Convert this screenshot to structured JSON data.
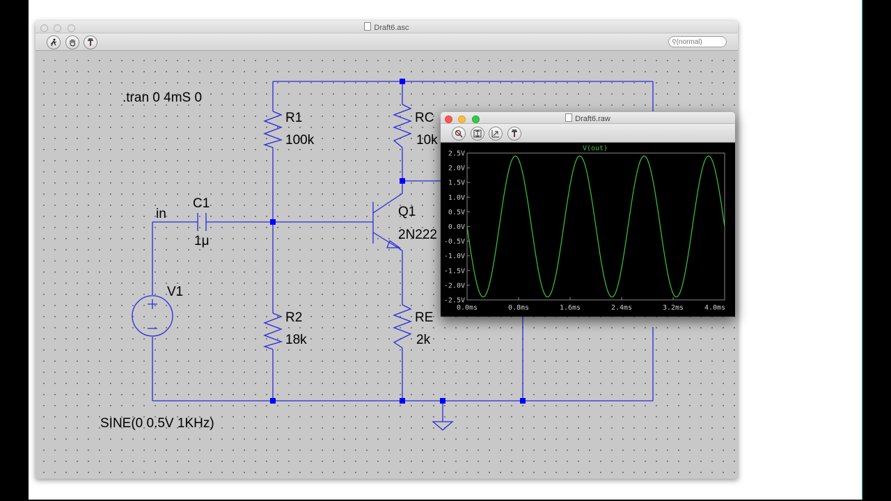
{
  "main_window": {
    "title": "Draft6.asc",
    "search_placeholder": "(normal)",
    "toolbar_icons": [
      "run-icon",
      "pan-hand-icon",
      "probe-icon"
    ]
  },
  "schematic": {
    "directive": ".tran 0 4mS 0",
    "source_spec": "SINE(0 0.5V 1KHz)",
    "net_label": "in",
    "components": {
      "R1": {
        "name": "R1",
        "value": "100k"
      },
      "R2": {
        "name": "R2",
        "value": "18k"
      },
      "RC": {
        "name": "RC",
        "value": "10k"
      },
      "RE": {
        "name": "RE",
        "value": "2k"
      },
      "C1": {
        "name": "C1",
        "value": "1μ"
      },
      "Q1": {
        "name": "Q1",
        "value": "2N222"
      },
      "V1": {
        "name": "V1"
      }
    },
    "colors": {
      "wire": "#2a2adf",
      "junction": "#0000ff"
    }
  },
  "waveform_window": {
    "title": "Draft6.raw",
    "toolbar_icons": [
      "autorange-icon",
      "zoom-extents-icon",
      "zoom-back-icon",
      "probe-icon"
    ]
  },
  "chart_data": {
    "type": "line",
    "title": "V(out)",
    "xlim": [
      0,
      4.0
    ],
    "ylim": [
      -2.5,
      2.5
    ],
    "x_ticks": [
      "0.0ms",
      "0.8ms",
      "1.6ms",
      "2.4ms",
      "3.2ms",
      "4.0ms"
    ],
    "y_ticks": [
      "2.5V",
      "2.0V",
      "1.5V",
      "1.0V",
      "0.5V",
      "0.0V",
      "-0.5V",
      "-1.0V",
      "-1.5V",
      "-2.0V",
      "-2.5V"
    ],
    "series": [
      {
        "name": "V(out)",
        "color": "#3ec63e",
        "amplitude": 2.4,
        "frequency_khz": 1,
        "phase": "inverted",
        "x_unit": "ms",
        "y_unit": "V"
      }
    ],
    "background": "#000000",
    "grid": false
  }
}
